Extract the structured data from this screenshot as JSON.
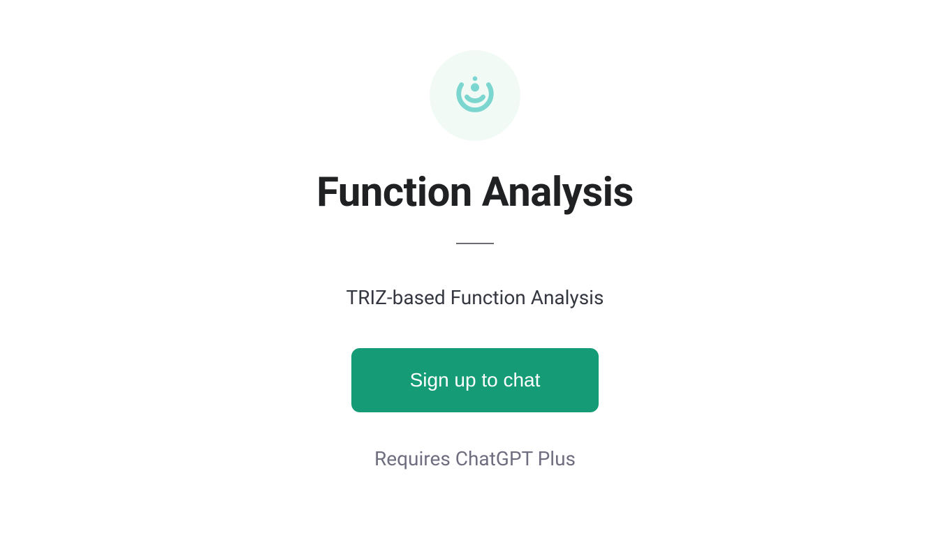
{
  "icon": {
    "name": "app-logo-icon",
    "color": "#7cd6d0",
    "bg": "#f2faf5"
  },
  "title": "Function Analysis",
  "subtitle": "TRIZ-based Function Analysis",
  "cta": {
    "label": "Sign up to chat",
    "bg": "#169b77",
    "color": "#ffffff"
  },
  "requires": "Requires ChatGPT Plus"
}
